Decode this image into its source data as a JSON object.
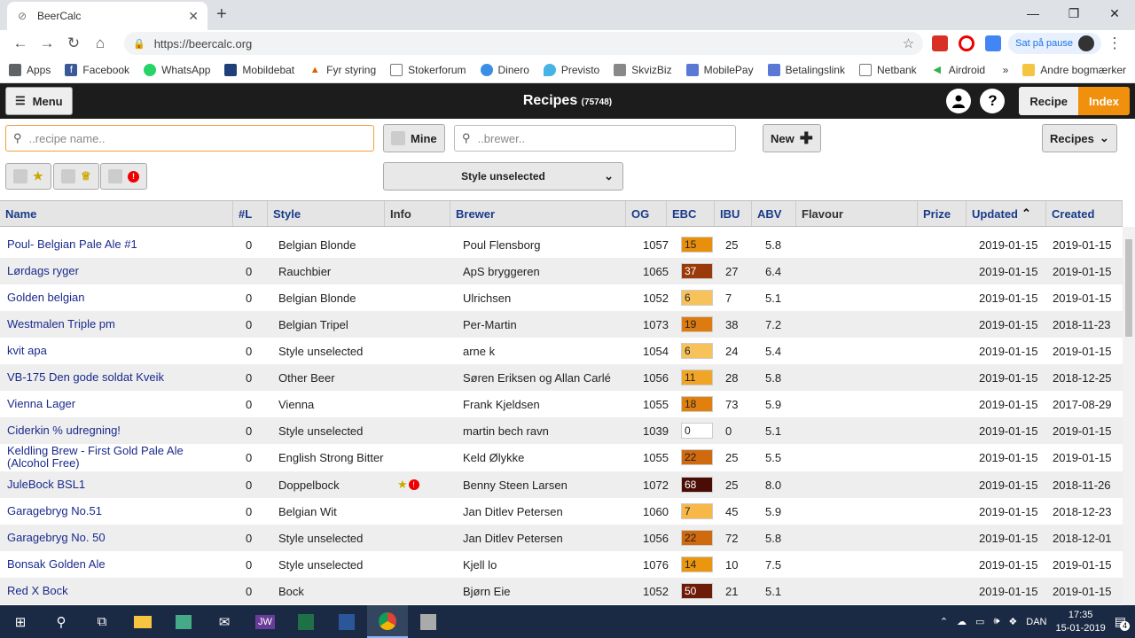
{
  "browser": {
    "tab_title": "BeerCalc",
    "url": "https://beercalc.org",
    "pause_label": "Sat på pause",
    "bookmarks": [
      "Apps",
      "Facebook",
      "WhatsApp",
      "Mobildebat",
      "Fyr styring",
      "Stokerforum",
      "Dinero",
      "Previsto",
      "SkvizBiz",
      "MobilePay",
      "Betalingslink",
      "Netbank",
      "Airdroid"
    ],
    "overflow": "»",
    "other_bookmarks": "Andre bogmærker"
  },
  "header": {
    "menu_label": "Menu",
    "title": "Recipes",
    "count": "(75748)",
    "recipe_label": "Recipe",
    "index_label": "Index",
    "help": "?"
  },
  "filters": {
    "recipe_placeholder": "..recipe name..",
    "mine_label": "Mine",
    "brewer_placeholder": "..brewer..",
    "new_label": "New",
    "recipes_dropdown": "Recipes",
    "style_dropdown": "Style unselected"
  },
  "table": {
    "columns": [
      "Name",
      "#L",
      "Style",
      "Info",
      "Brewer",
      "OG",
      "EBC",
      "IBU",
      "ABV",
      "Flavour",
      "Prize",
      "Updated",
      "Created"
    ],
    "rows": [
      {
        "name": "Poul- Belgian Pale Ale #1",
        "l": "0",
        "style": "Belgian Blonde",
        "info": "",
        "brewer": "Poul Flensborg",
        "og": "1057",
        "ebc": "15",
        "ebc_color": "#e8900c",
        "ebc_text": "#222",
        "ibu": "25",
        "abv": "5.8",
        "updated": "2019-01-15",
        "created": "2019-01-15"
      },
      {
        "name": "Lørdags ryger",
        "l": "0",
        "style": "Rauchbier",
        "info": "",
        "brewer": "ApS bryggeren",
        "og": "1065",
        "ebc": "37",
        "ebc_color": "#9a3a0a",
        "ebc_text": "#fff",
        "ibu": "27",
        "abv": "6.4",
        "updated": "2019-01-15",
        "created": "2019-01-15"
      },
      {
        "name": "Golden belgian",
        "l": "0",
        "style": "Belgian Blonde",
        "info": "",
        "brewer": "Ulrichsen",
        "og": "1052",
        "ebc": "6",
        "ebc_color": "#f8c25a",
        "ebc_text": "#222",
        "ibu": "7",
        "abv": "5.1",
        "updated": "2019-01-15",
        "created": "2019-01-15"
      },
      {
        "name": "Westmalen Triple pm",
        "l": "0",
        "style": "Belgian Tripel",
        "info": "",
        "brewer": "Per-Martin",
        "og": "1073",
        "ebc": "19",
        "ebc_color": "#dd7a10",
        "ebc_text": "#222",
        "ibu": "38",
        "abv": "7.2",
        "updated": "2019-01-15",
        "created": "2018-11-23"
      },
      {
        "name": "kvit apa",
        "l": "0",
        "style": "Style unselected",
        "info": "",
        "brewer": "arne k",
        "og": "1054",
        "ebc": "6",
        "ebc_color": "#f8c25a",
        "ebc_text": "#222",
        "ibu": "24",
        "abv": "5.4",
        "updated": "2019-01-15",
        "created": "2019-01-15"
      },
      {
        "name": "VB-175 Den gode soldat Kveik",
        "l": "0",
        "style": "Other Beer",
        "info": "",
        "brewer": "Søren Eriksen og Allan Carlé",
        "og": "1056",
        "ebc": "11",
        "ebc_color": "#f0a526",
        "ebc_text": "#222",
        "ibu": "28",
        "abv": "5.8",
        "updated": "2019-01-15",
        "created": "2018-12-25"
      },
      {
        "name": "Vienna Lager",
        "l": "0",
        "style": "Vienna",
        "info": "",
        "brewer": "Frank Kjeldsen",
        "og": "1055",
        "ebc": "18",
        "ebc_color": "#e2800e",
        "ebc_text": "#222",
        "ibu": "73",
        "abv": "5.9",
        "updated": "2019-01-15",
        "created": "2017-08-29"
      },
      {
        "name": "Ciderkin % udregning!",
        "l": "0",
        "style": "Style unselected",
        "info": "",
        "brewer": "martin bech ravn",
        "og": "1039",
        "ebc": "0",
        "ebc_color": "#ffffff",
        "ebc_text": "#222",
        "ibu": "0",
        "abv": "5.1",
        "updated": "2019-01-15",
        "created": "2019-01-15"
      },
      {
        "name": "Keldling Brew - First Gold Pale Ale (Alcohol Free)",
        "l": "0",
        "style": "English Strong Bitter",
        "info": "",
        "brewer": "Keld Ølykke",
        "og": "1055",
        "ebc": "22",
        "ebc_color": "#d06a0e",
        "ebc_text": "#222",
        "ibu": "25",
        "abv": "5.5",
        "updated": "2019-01-15",
        "created": "2019-01-15"
      },
      {
        "name": "JuleBock BSL1",
        "l": "0",
        "style": "Doppelbock",
        "info": "★!",
        "brewer": "Benny Steen Larsen",
        "og": "1072",
        "ebc": "68",
        "ebc_color": "#4a0d05",
        "ebc_text": "#fff",
        "ibu": "25",
        "abv": "8.0",
        "updated": "2019-01-15",
        "created": "2018-11-26"
      },
      {
        "name": "Garagebryg No.51",
        "l": "0",
        "style": "Belgian Wit",
        "info": "",
        "brewer": "Jan Ditlev Petersen",
        "og": "1060",
        "ebc": "7",
        "ebc_color": "#f8b848",
        "ebc_text": "#222",
        "ibu": "45",
        "abv": "5.9",
        "updated": "2019-01-15",
        "created": "2018-12-23"
      },
      {
        "name": "Garagebryg No. 50",
        "l": "0",
        "style": "Style unselected",
        "info": "",
        "brewer": "Jan Ditlev Petersen",
        "og": "1056",
        "ebc": "22",
        "ebc_color": "#d06a0e",
        "ebc_text": "#222",
        "ibu": "72",
        "abv": "5.8",
        "updated": "2019-01-15",
        "created": "2018-12-01"
      },
      {
        "name": "Bonsak Golden Ale",
        "l": "0",
        "style": "Style unselected",
        "info": "",
        "brewer": "Kjell lo",
        "og": "1076",
        "ebc": "14",
        "ebc_color": "#ea960f",
        "ebc_text": "#222",
        "ibu": "10",
        "abv": "7.5",
        "updated": "2019-01-15",
        "created": "2019-01-15"
      },
      {
        "name": "Red X Bock",
        "l": "0",
        "style": "Bock",
        "info": "",
        "brewer": "Bjørn Eie",
        "og": "1052",
        "ebc": "50",
        "ebc_color": "#6e1a08",
        "ebc_text": "#fff",
        "ibu": "21",
        "abv": "5.1",
        "updated": "2019-01-15",
        "created": "2019-01-15"
      }
    ]
  },
  "taskbar": {
    "language": "DAN",
    "time": "17:35",
    "date": "15-01-2019",
    "notif_count": "4",
    "jw_label": "JW"
  }
}
